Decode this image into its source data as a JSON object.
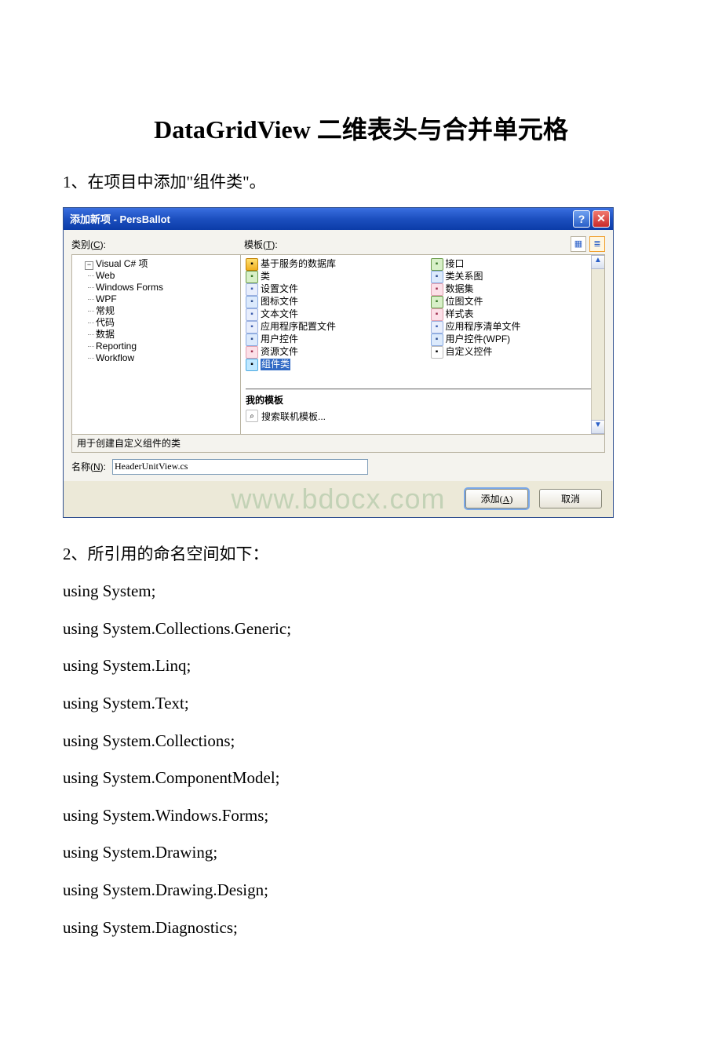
{
  "doc": {
    "title": "DataGridView 二维表头与合并单元格",
    "para1": "1、在项目中添加\"组件类\"。",
    "para2": "2、所引用的命名空间如下：",
    "code": [
      "using System;",
      "using System.Collections.Generic;",
      "using System.Linq;",
      "using System.Text;",
      "using System.Collections;",
      "using System.ComponentModel;",
      "using System.Windows.Forms;",
      "using System.Drawing;",
      "using System.Drawing.Design;",
      "using System.Diagnostics;"
    ]
  },
  "dialog": {
    "title": "添加新项 - PersBallot",
    "category_label_pre": "类别(",
    "category_label_u": "C",
    "category_label_post": "):",
    "template_label_pre": "模板(",
    "template_label_u": "T",
    "template_label_post": "):",
    "tree": {
      "root": "Visual C# 项",
      "children": [
        "Web",
        "Windows Forms",
        "WPF",
        "常规",
        "代码",
        "数据",
        "Reporting",
        "Workflow"
      ]
    },
    "templates_col1": [
      {
        "icon": "db",
        "label": "基于服务的数据库"
      },
      {
        "icon": "cs",
        "label": "类"
      },
      {
        "icon": "pg",
        "label": "设置文件"
      },
      {
        "icon": "bl",
        "label": "图标文件"
      },
      {
        "icon": "pg",
        "label": "文本文件"
      },
      {
        "icon": "pg",
        "label": "应用程序配置文件"
      },
      {
        "icon": "bl",
        "label": "用户控件"
      },
      {
        "icon": "rd",
        "label": "资源文件"
      },
      {
        "icon": "sel",
        "label": "组件类",
        "selected": true
      }
    ],
    "templates_col2": [
      {
        "icon": "cs",
        "label": "接口"
      },
      {
        "icon": "bl",
        "label": "类关系图"
      },
      {
        "icon": "rd",
        "label": "数据集"
      },
      {
        "icon": "cs",
        "label": "位图文件"
      },
      {
        "icon": "rd",
        "label": "样式表"
      },
      {
        "icon": "pg",
        "label": "应用程序清单文件"
      },
      {
        "icon": "bl",
        "label": "用户控件(WPF)"
      },
      {
        "icon": "txt",
        "label": "自定义控件"
      }
    ],
    "my_templates_header": "我的模板",
    "search_online": "搜索联机模板...",
    "description": "用于创建自定义组件的类",
    "name_label_pre": "名称(",
    "name_label_u": "N",
    "name_label_post": "):",
    "name_value": "HeaderUnitView.cs",
    "watermark": "www.bdocx.com",
    "add_btn_pre": "添加(",
    "add_btn_u": "A",
    "add_btn_post": ")",
    "cancel_btn": "取消",
    "view_large_tip": "大图标视图",
    "view_small_tip": "小图标视图",
    "scroll_up": "▲",
    "scroll_down": "▼",
    "help_tip": "帮助",
    "close_tip": "关闭"
  }
}
